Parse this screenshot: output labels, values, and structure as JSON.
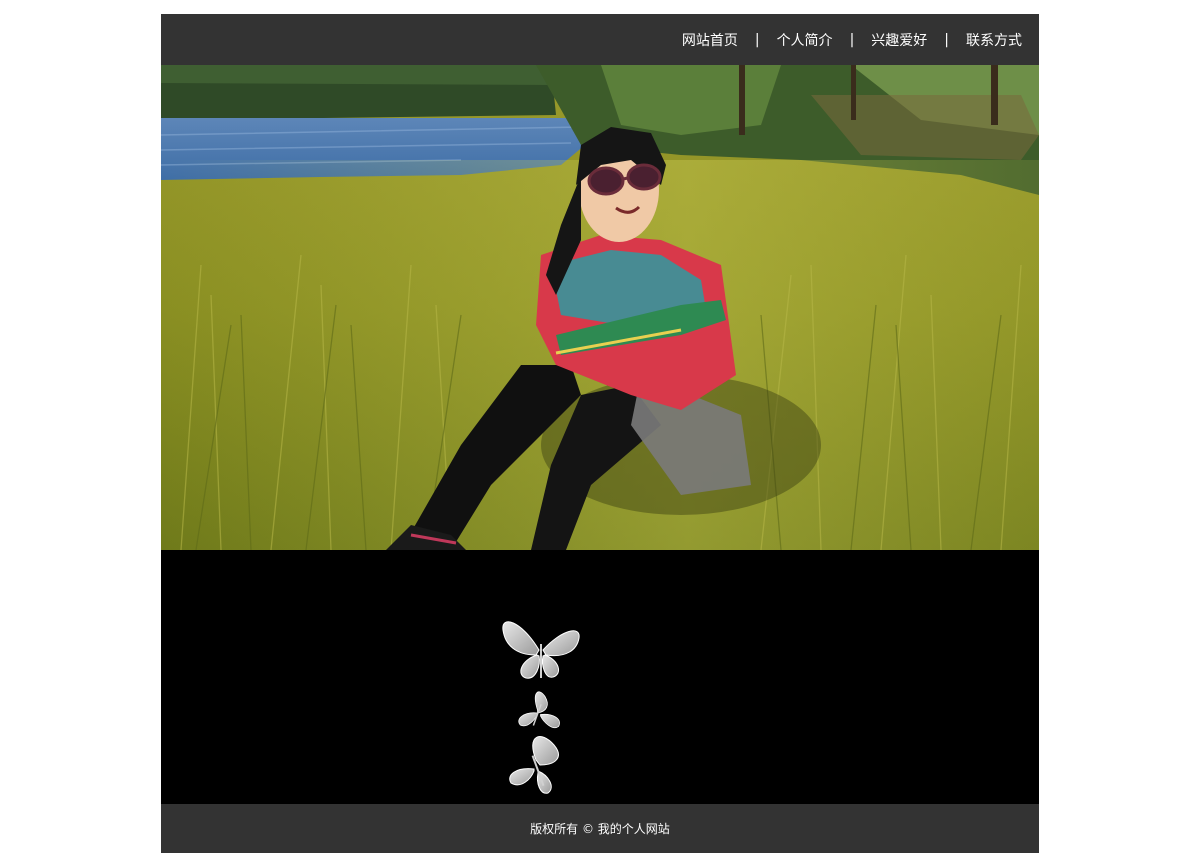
{
  "nav": {
    "items": [
      {
        "label": "网站首页"
      },
      {
        "label": "个人简介"
      },
      {
        "label": "兴趣爱好"
      },
      {
        "label": "联系方式"
      }
    ],
    "separator": "|"
  },
  "hero": {
    "image_icon": "photo-woman-sitting-in-grass-by-lake"
  },
  "decoration": {
    "icon": "butterfly-icon",
    "count": 3
  },
  "footer": {
    "copyright": "版权所有 © 我的个人网站"
  },
  "colors": {
    "navbar_bg": "#333333",
    "footer_bg": "#333333",
    "black_section_bg": "#000000",
    "text": "#ffffff"
  }
}
